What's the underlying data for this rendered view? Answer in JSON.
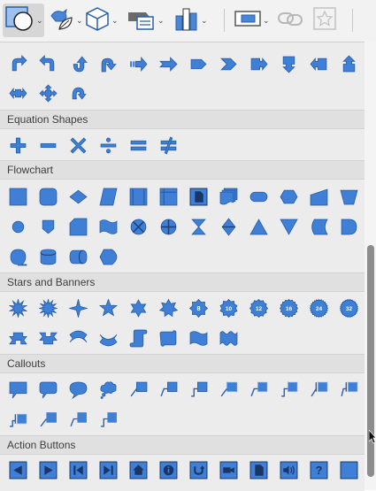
{
  "colors": {
    "shape_fill": "#3f7fd6",
    "shape_stroke": "#2a5fa8",
    "panel_bg": "#ececec",
    "header_bg": "#e0e0e0"
  },
  "toolbar": {
    "items": [
      {
        "name": "shapes",
        "icon": "square-circle-shapes-icon",
        "has_menu": true,
        "active": true
      },
      {
        "name": "icons",
        "icon": "bird-leaf-icons-icon",
        "has_menu": true
      },
      {
        "name": "3d-models",
        "icon": "cube-3d-icon",
        "has_menu": true
      },
      {
        "name": "smartart",
        "icon": "smartart-icon",
        "has_menu": true
      },
      {
        "name": "chart",
        "icon": "chart-bars-icon",
        "has_menu": true
      },
      {
        "name": "screenshot",
        "icon": "screenshot-icon",
        "has_menu": true
      },
      {
        "name": "link",
        "icon": "link-icon",
        "has_menu": false
      },
      {
        "name": "favorite",
        "icon": "star-frame-icon",
        "has_menu": false
      }
    ]
  },
  "sections": {
    "block_arrows_tail": {
      "rows": [
        [
          "u-turn-right",
          "u-turn-left",
          "curved-up",
          "curved-right",
          "striped-right",
          "notched-right",
          "pentagon",
          "chevron",
          "right-callout",
          "down-callout",
          "left-callout",
          "up-callout"
        ],
        [
          "left-right-callout",
          "quad-callout",
          "circular-arrow"
        ]
      ]
    },
    "equation": {
      "title": "Equation Shapes",
      "rows": [
        [
          "plus",
          "minus",
          "multiply",
          "division",
          "equal",
          "not-equal"
        ]
      ]
    },
    "flowchart": {
      "title": "Flowchart",
      "rows": [
        [
          "process",
          "alternate-process",
          "decision",
          "data",
          "predefined-process",
          "internal-storage",
          "document",
          "multidocument",
          "terminator",
          "preparation",
          "manual-input",
          "manual-operation"
        ],
        [
          "connector",
          "offpage-connector",
          "card",
          "punched-tape",
          "summing-junction",
          "or",
          "collate",
          "sort",
          "extract",
          "merge",
          "stored-data",
          "delay"
        ],
        [
          "sequential-access-storage",
          "magnetic-disk",
          "direct-access-storage",
          "display"
        ]
      ]
    },
    "stars": {
      "title": "Stars and Banners",
      "rows": [
        [
          "explosion-1",
          "explosion-2",
          "star-4",
          "star-5",
          "star-6",
          "star-7",
          "star-8",
          "star-10",
          "star-12",
          "star-16",
          "star-24",
          "star-32"
        ],
        [
          "up-ribbon",
          "down-ribbon",
          "curved-up-ribbon",
          "curved-down-ribbon",
          "vertical-scroll",
          "horizontal-scroll",
          "wave",
          "double-wave"
        ]
      ],
      "labels": {
        "star-8": "8",
        "star-10": "10",
        "star-12": "12",
        "star-16": "16",
        "star-24": "24",
        "star-32": "32"
      }
    },
    "callouts": {
      "title": "Callouts",
      "rows": [
        [
          "rect-callout",
          "rounded-rect-callout",
          "oval-callout",
          "cloud-callout",
          "line-callout-1",
          "line-callout-2",
          "line-callout-3",
          "line-callout-1-border",
          "line-callout-2-border",
          "line-callout-3-border",
          "line-callout-1-accent",
          "line-callout-2-accent"
        ],
        [
          "line-callout-3-accent",
          "line-callout-1-no-border",
          "line-callout-2-no-border",
          "line-callout-3-no-border"
        ]
      ]
    },
    "action": {
      "title": "Action Buttons",
      "rows": [
        [
          "back",
          "forward",
          "beginning",
          "end",
          "home",
          "information",
          "return",
          "movie",
          "document",
          "sound",
          "help",
          "custom"
        ]
      ]
    }
  }
}
